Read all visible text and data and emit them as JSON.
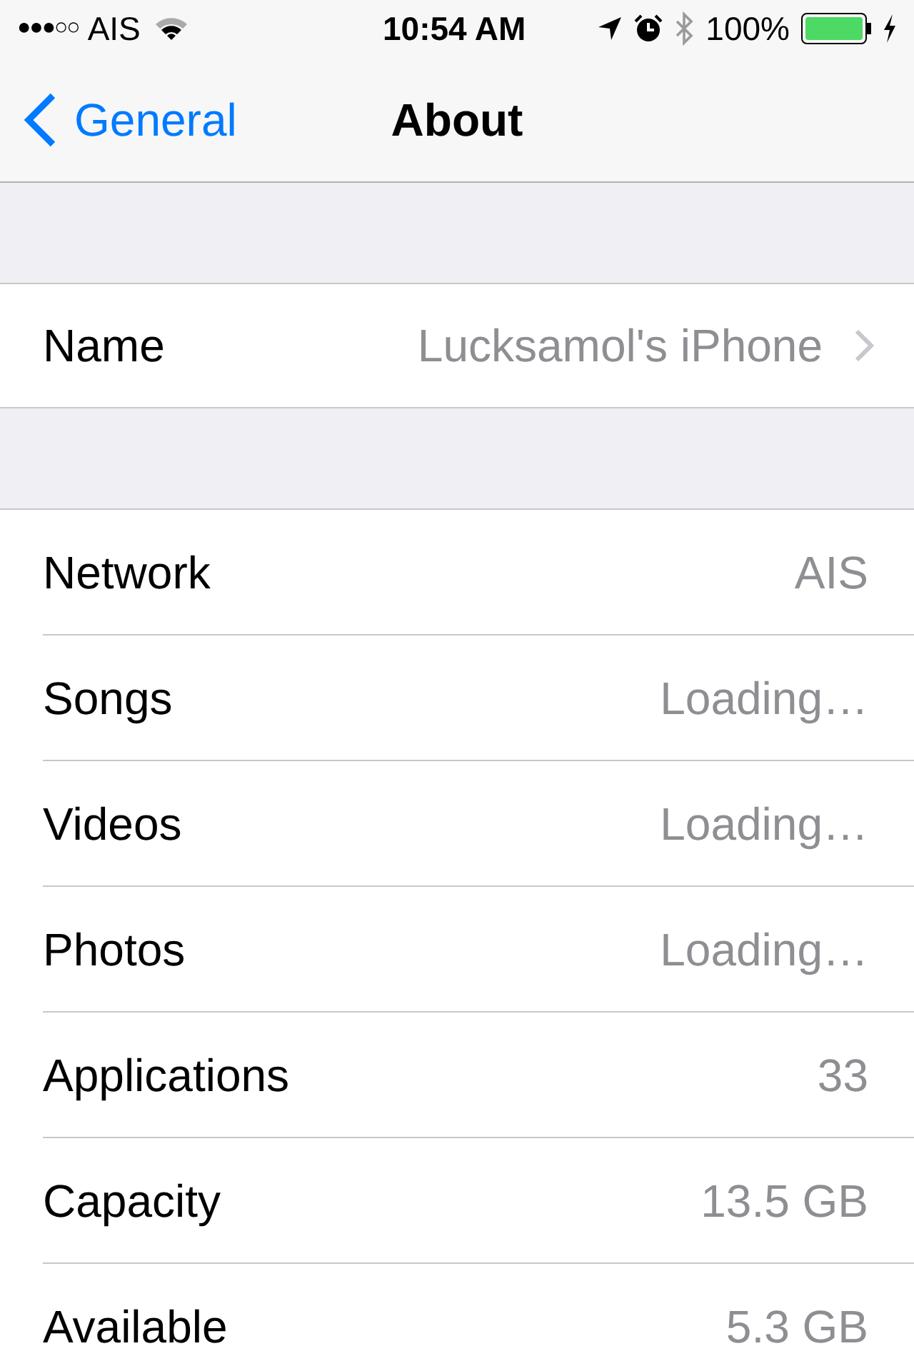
{
  "status_bar": {
    "signal": "●●●○○",
    "carrier": "AIS",
    "time": "10:54 AM",
    "bluetooth_on": false,
    "battery": "100%"
  },
  "nav": {
    "back": "General",
    "title": "About"
  },
  "name_row": {
    "label": "Name",
    "value": "Lucksamol's iPhone"
  },
  "rows": [
    {
      "label": "Network",
      "value": "AIS"
    },
    {
      "label": "Songs",
      "value": "Loading…"
    },
    {
      "label": "Videos",
      "value": "Loading…"
    },
    {
      "label": "Photos",
      "value": "Loading…"
    },
    {
      "label": "Applications",
      "value": "33"
    },
    {
      "label": "Capacity",
      "value": "13.5 GB"
    },
    {
      "label": "Available",
      "value": "5.3 GB"
    }
  ]
}
